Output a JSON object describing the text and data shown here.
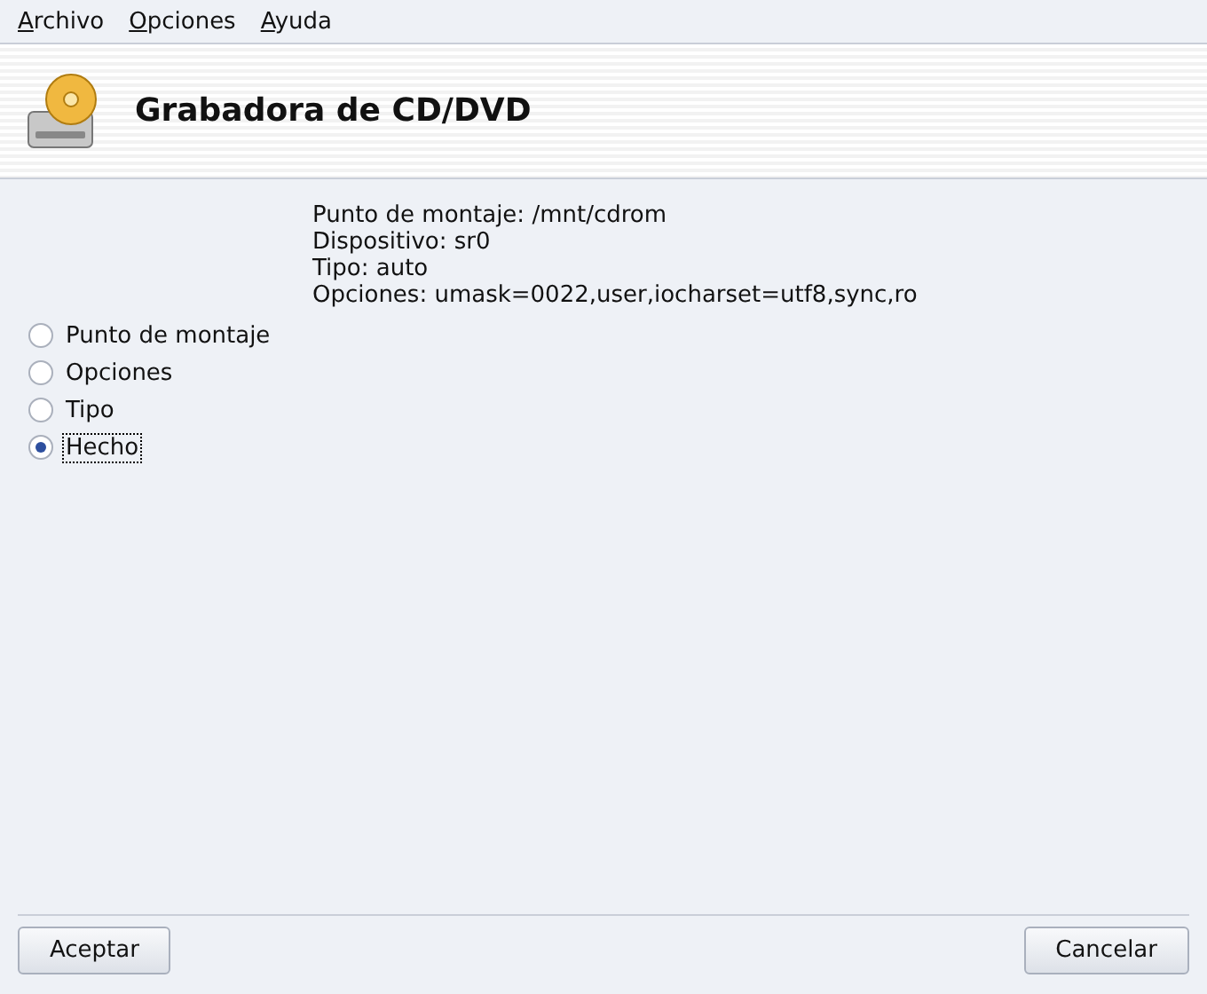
{
  "menu": [
    "Archivo",
    "Opciones",
    "Ayuda"
  ],
  "header": {
    "title": "Grabadora de CD/DVD"
  },
  "info": [
    "Punto de montaje: /mnt/cdrom",
    "Dispositivo: sr0",
    "Tipo: auto",
    "Opciones: umask=0022,user,iocharset=utf8,sync,ro"
  ],
  "options": [
    {
      "label": "Punto de montaje",
      "selected": false
    },
    {
      "label": "Opciones",
      "selected": false
    },
    {
      "label": "Tipo",
      "selected": false
    },
    {
      "label": "Hecho",
      "selected": true
    }
  ],
  "buttons": [
    "Aceptar",
    "Cancelar"
  ]
}
